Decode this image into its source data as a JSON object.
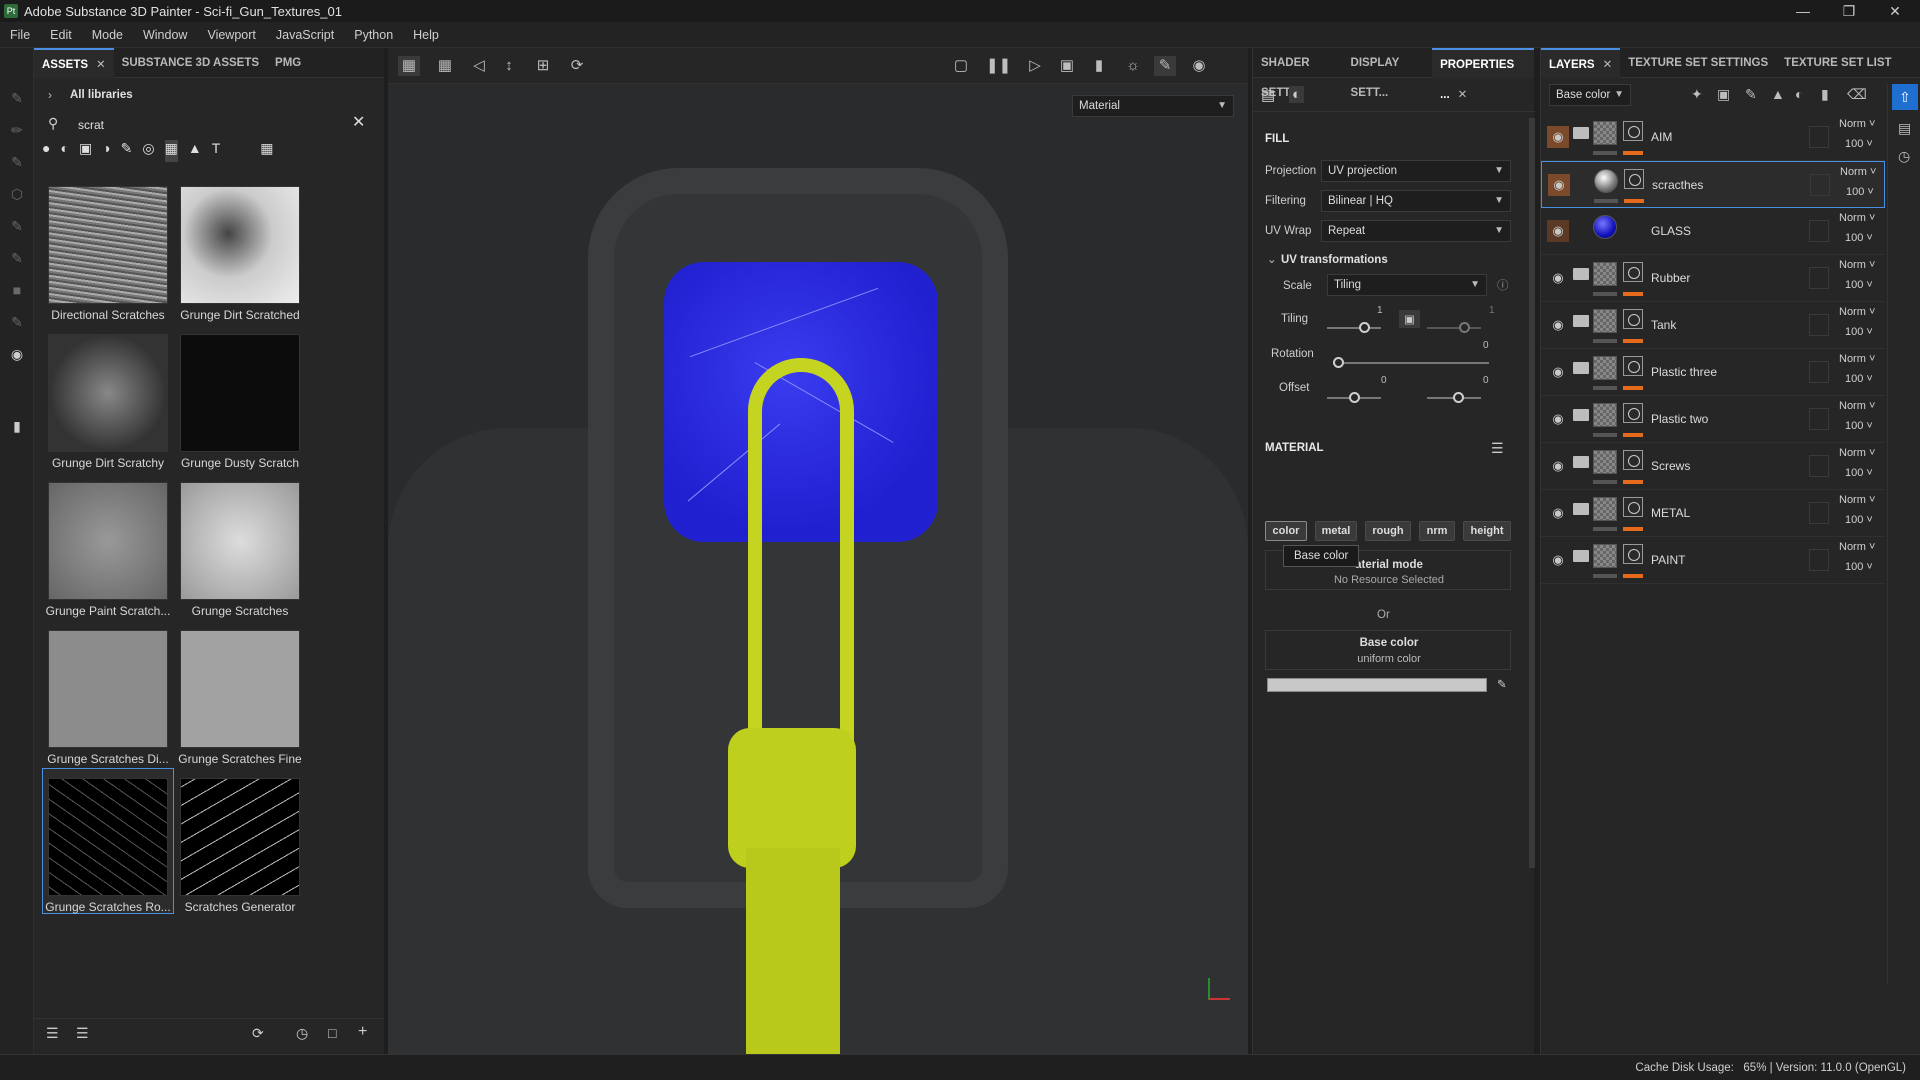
{
  "titlebar": {
    "app_title": "Adobe Substance 3D Painter - Sci-fi_Gun_Textures_01",
    "logo": "Pt"
  },
  "menu": [
    "File",
    "Edit",
    "Mode",
    "Window",
    "Viewport",
    "JavaScript",
    "Python",
    "Help"
  ],
  "assets": {
    "tabs": [
      "ASSETS",
      "SUBSTANCE 3D ASSETS",
      "PMG"
    ],
    "breadcrumb": "All libraries",
    "search_value": "scrat",
    "items": [
      {
        "label": "Directional Scratches"
      },
      {
        "label": "Grunge Dirt Scratched"
      },
      {
        "label": "Grunge Dirt Scratchy"
      },
      {
        "label": "Grunge Dusty Scratch"
      },
      {
        "label": "Grunge Paint Scratch..."
      },
      {
        "label": "Grunge Scratches"
      },
      {
        "label": "Grunge Scratches Di..."
      },
      {
        "label": "Grunge Scratches Fine"
      },
      {
        "label": "Grunge Scratches Ro..."
      },
      {
        "label": "Scratches Generator"
      }
    ]
  },
  "viewport": {
    "mode_select": "Material"
  },
  "properties": {
    "tabs": [
      "SHADER SETT...",
      "DISPLAY SETT...",
      "PROPERTIES ..."
    ],
    "fill_header": "FILL",
    "projection": {
      "label": "Projection",
      "value": "UV projection"
    },
    "filtering": {
      "label": "Filtering",
      "value": "Bilinear | HQ"
    },
    "uvwrap": {
      "label": "UV Wrap",
      "value": "Repeat"
    },
    "uv_transformations": "UV transformations",
    "scale": {
      "label": "Scale",
      "value": "Tiling"
    },
    "tiling": {
      "label": "Tiling",
      "v1": "1",
      "v2": "1"
    },
    "rotation": {
      "label": "Rotation",
      "value": "0"
    },
    "offset": {
      "label": "Offset",
      "v1": "0",
      "v2": "0"
    },
    "material_header": "MATERIAL",
    "channels": [
      "color",
      "metal",
      "rough",
      "nrm",
      "height"
    ],
    "tooltip": "Base color",
    "material_mode": "aterial mode",
    "no_resource": "No Resource Selected",
    "or": "Or",
    "base_color_title": "Base color",
    "base_color_sub": "uniform color",
    "base_color_hex": "#c8c8c8"
  },
  "layers": {
    "tabs": [
      "LAYERS",
      "TEXTURE SET SETTINGS",
      "TEXTURE SET LIST"
    ],
    "channel_select": "Base color",
    "rows": [
      {
        "name": "AIM",
        "blend": "Norm",
        "opacity": "100"
      },
      {
        "name": "scracthes",
        "blend": "Norm",
        "opacity": "100"
      },
      {
        "name": "GLASS",
        "blend": "Norm",
        "opacity": "100"
      },
      {
        "name": "Rubber",
        "blend": "Norm",
        "opacity": "100"
      },
      {
        "name": "Tank",
        "blend": "Norm",
        "opacity": "100"
      },
      {
        "name": "Plastic three",
        "blend": "Norm",
        "opacity": "100"
      },
      {
        "name": "Plastic two",
        "blend": "Norm",
        "opacity": "100"
      },
      {
        "name": "Screws",
        "blend": "Norm",
        "opacity": "100"
      },
      {
        "name": "METAL",
        "blend": "Norm",
        "opacity": "100"
      },
      {
        "name": "PAINT",
        "blend": "Norm",
        "opacity": "100"
      }
    ]
  },
  "status": {
    "text": "Cache Disk Usage:   65% | Version: 11.0.0 (OpenGL)"
  }
}
